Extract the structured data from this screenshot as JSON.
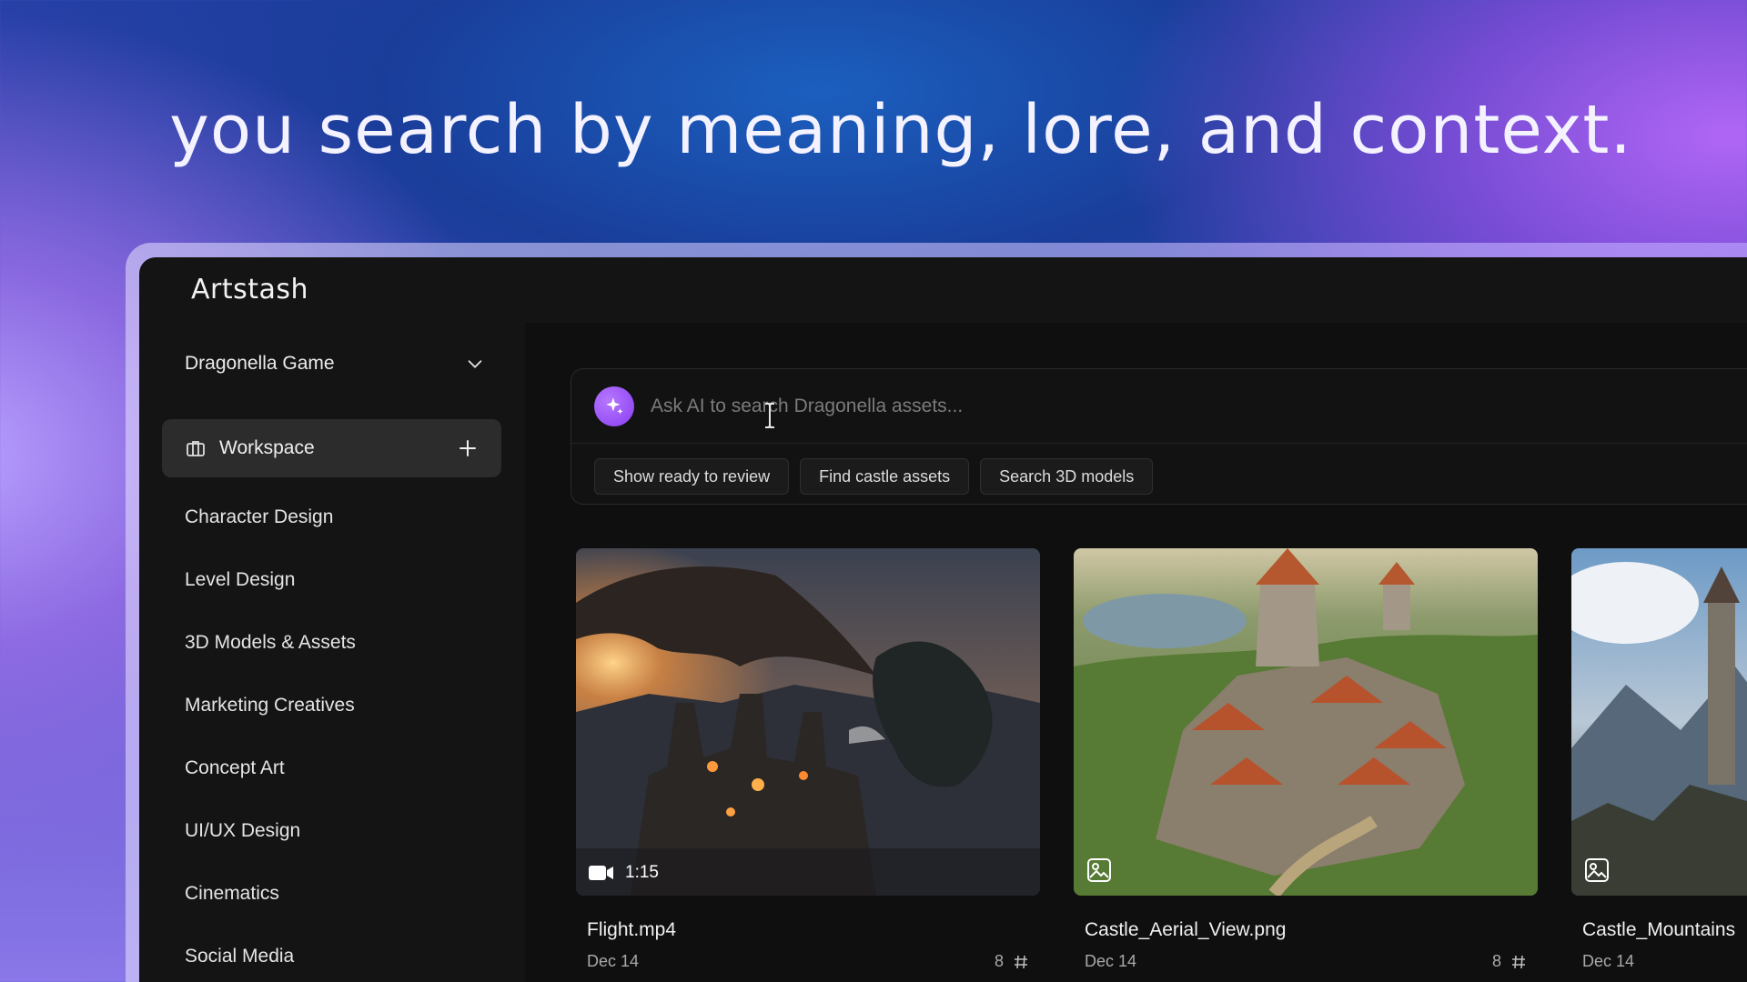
{
  "headline": "you search by meaning, lore, and context.",
  "app": {
    "brand": "Artstash",
    "project": "Dragonella Game",
    "workspace": "Workspace",
    "nav": [
      "Character Design",
      "Level Design",
      "3D Models & Assets",
      "Marketing Creatives",
      "Concept Art",
      "UI/UX Design",
      "Cinematics",
      "Social Media"
    ],
    "search": {
      "placeholder": "Ask AI to search Dragonella assets...",
      "chips": [
        "Show ready to review",
        "Find castle assets",
        "Search 3D models"
      ]
    },
    "cards": [
      {
        "title": "Flight.mp4",
        "date": "Dec 14",
        "count": "8",
        "duration": "1:15",
        "kind": "video"
      },
      {
        "title": "Castle_Aerial_View.png",
        "date": "Dec 14",
        "count": "8",
        "kind": "image"
      },
      {
        "title": "Castle_Mountains",
        "date": "Dec 14",
        "kind": "image"
      }
    ]
  },
  "colors": {
    "accent": "#8a3df0",
    "sidebar_bg": "#141414",
    "active_item_bg": "#2c2c2c"
  },
  "icons": [
    "chevron-down-icon",
    "briefcase-icon",
    "plus-icon",
    "sparkle-icon",
    "video-icon",
    "image-icon",
    "hash-icon"
  ]
}
